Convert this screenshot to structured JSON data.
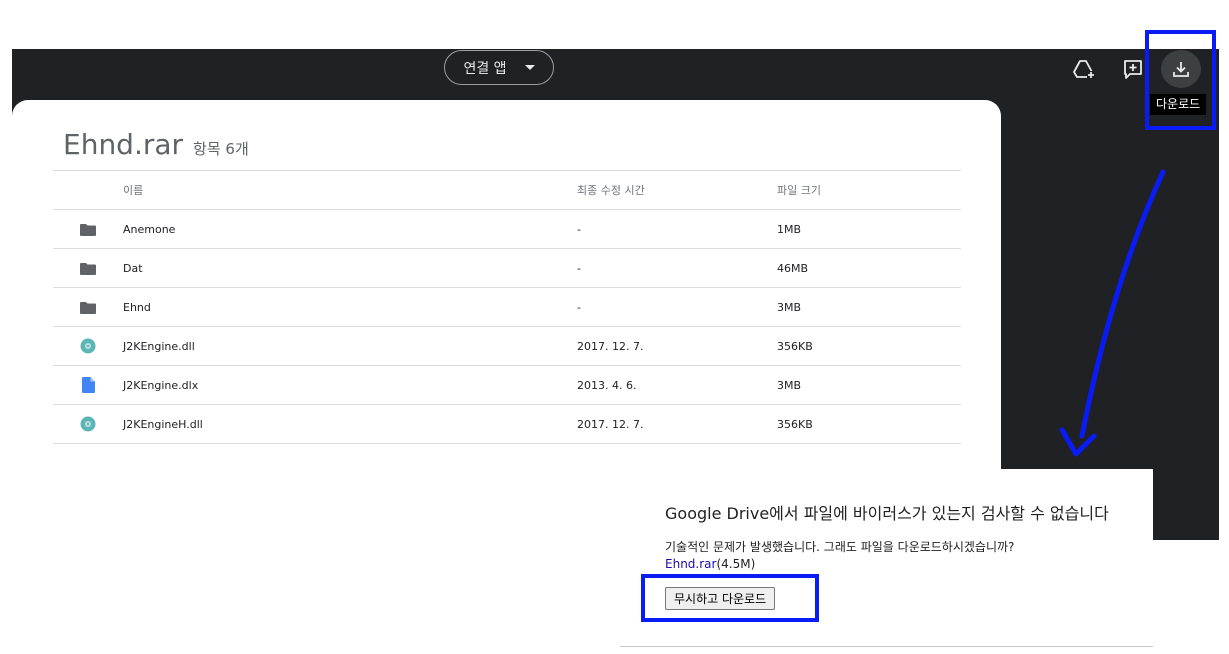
{
  "toolbar": {
    "open_with_label": "연결 앱",
    "download_tooltip": "다운로드"
  },
  "archive": {
    "name": "Ehnd.rar",
    "item_count": "항목 6개",
    "columns": {
      "name": "이름",
      "modified": "최종 수정 시간",
      "size": "파일 크기"
    },
    "rows": [
      {
        "icon": "folder-icon",
        "name": "Anemone",
        "modified": "-",
        "size": "1MB"
      },
      {
        "icon": "folder-icon",
        "name": "Dat",
        "modified": "-",
        "size": "46MB"
      },
      {
        "icon": "folder-icon",
        "name": "Ehnd",
        "modified": "-",
        "size": "3MB"
      },
      {
        "icon": "disc-icon",
        "name": "J2KEngine.dll",
        "modified": "2017. 12. 7.",
        "size": "356KB"
      },
      {
        "icon": "document-icon",
        "name": "J2KEngine.dlx",
        "modified": "2013. 4. 6.",
        "size": "3MB"
      },
      {
        "icon": "disc-icon",
        "name": "J2KEngineH.dll",
        "modified": "2017. 12. 7.",
        "size": "356KB"
      }
    ]
  },
  "warning": {
    "title": "Google Drive에서 파일에 바이러스가 있는지 검사할 수 없습니다",
    "message": "기술적인 문제가 발생했습니다. 그래도 파일을 다운로드하시겠습니까?",
    "file_link": "Ehnd.rar",
    "file_size": "(4.5M)",
    "button_label": "무시하고 다운로드"
  },
  "colors": {
    "viewer_bg": "#202124",
    "highlight": "#0a1cf5",
    "disc_icon": "#5bb5b5",
    "document_icon": "#4285f4",
    "folder_icon": "#5f6368"
  }
}
